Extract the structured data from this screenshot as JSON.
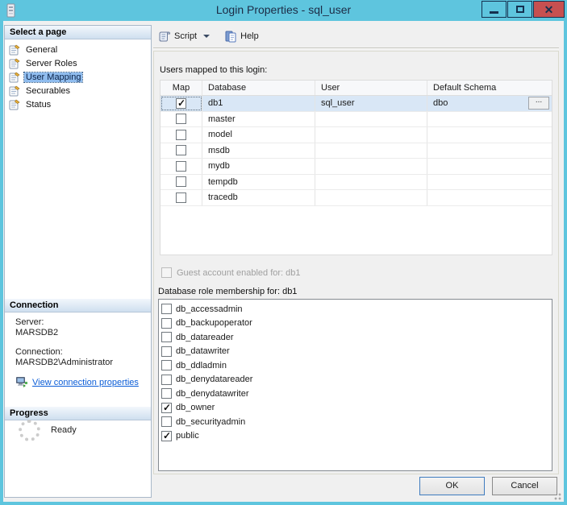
{
  "window": {
    "title": "Login Properties - sql_user",
    "controls": {
      "minimize": "minimize",
      "maximize": "maximize",
      "close": "close"
    }
  },
  "colors": {
    "chrome_blue": "#5ec5de",
    "close_red": "#c75050",
    "selection_blue": "#8fbcee",
    "row_selected": "#d9e7f6",
    "link_blue": "#0b5dd7"
  },
  "sidebar": {
    "select_page_header": "Select a page",
    "pages": [
      {
        "label": "General",
        "selected": false
      },
      {
        "label": "Server Roles",
        "selected": false
      },
      {
        "label": "User Mapping",
        "selected": true
      },
      {
        "label": "Securables",
        "selected": false
      },
      {
        "label": "Status",
        "selected": false
      }
    ],
    "connection_header": "Connection",
    "server_label": "Server:",
    "server_value": "MARSDB2",
    "connection_label": "Connection:",
    "connection_value": "MARSDB2\\Administrator",
    "link_label": "View connection properties",
    "progress_header": "Progress",
    "progress_status": "Ready"
  },
  "toolbar": {
    "script_label": "Script",
    "help_label": "Help"
  },
  "main": {
    "users_mapped_label": "Users mapped to this login:",
    "table": {
      "columns": [
        "Map",
        "Database",
        "User",
        "Default Schema"
      ],
      "browse_label": "...",
      "rows": [
        {
          "map": true,
          "database": "db1",
          "user": "sql_user",
          "default_schema": "dbo",
          "selected": true,
          "browse": true
        },
        {
          "map": false,
          "database": "master",
          "user": "",
          "default_schema": "",
          "selected": false,
          "browse": false
        },
        {
          "map": false,
          "database": "model",
          "user": "",
          "default_schema": "",
          "selected": false,
          "browse": false
        },
        {
          "map": false,
          "database": "msdb",
          "user": "",
          "default_schema": "",
          "selected": false,
          "browse": false
        },
        {
          "map": false,
          "database": "mydb",
          "user": "",
          "default_schema": "",
          "selected": false,
          "browse": false
        },
        {
          "map": false,
          "database": "tempdb",
          "user": "",
          "default_schema": "",
          "selected": false,
          "browse": false
        },
        {
          "map": false,
          "database": "tracedb",
          "user": "",
          "default_schema": "",
          "selected": false,
          "browse": false
        }
      ]
    },
    "guest_label": "Guest account enabled for: db1",
    "guest_checked": false,
    "roles_label": "Database role membership for: db1",
    "roles": [
      {
        "label": "db_accessadmin",
        "checked": false
      },
      {
        "label": "db_backupoperator",
        "checked": false
      },
      {
        "label": "db_datareader",
        "checked": false
      },
      {
        "label": "db_datawriter",
        "checked": false
      },
      {
        "label": "db_ddladmin",
        "checked": false
      },
      {
        "label": "db_denydatareader",
        "checked": false
      },
      {
        "label": "db_denydatawriter",
        "checked": false
      },
      {
        "label": "db_owner",
        "checked": true
      },
      {
        "label": "db_securityadmin",
        "checked": false
      },
      {
        "label": "public",
        "checked": true
      }
    ]
  },
  "footer": {
    "ok_label": "OK",
    "cancel_label": "Cancel"
  }
}
